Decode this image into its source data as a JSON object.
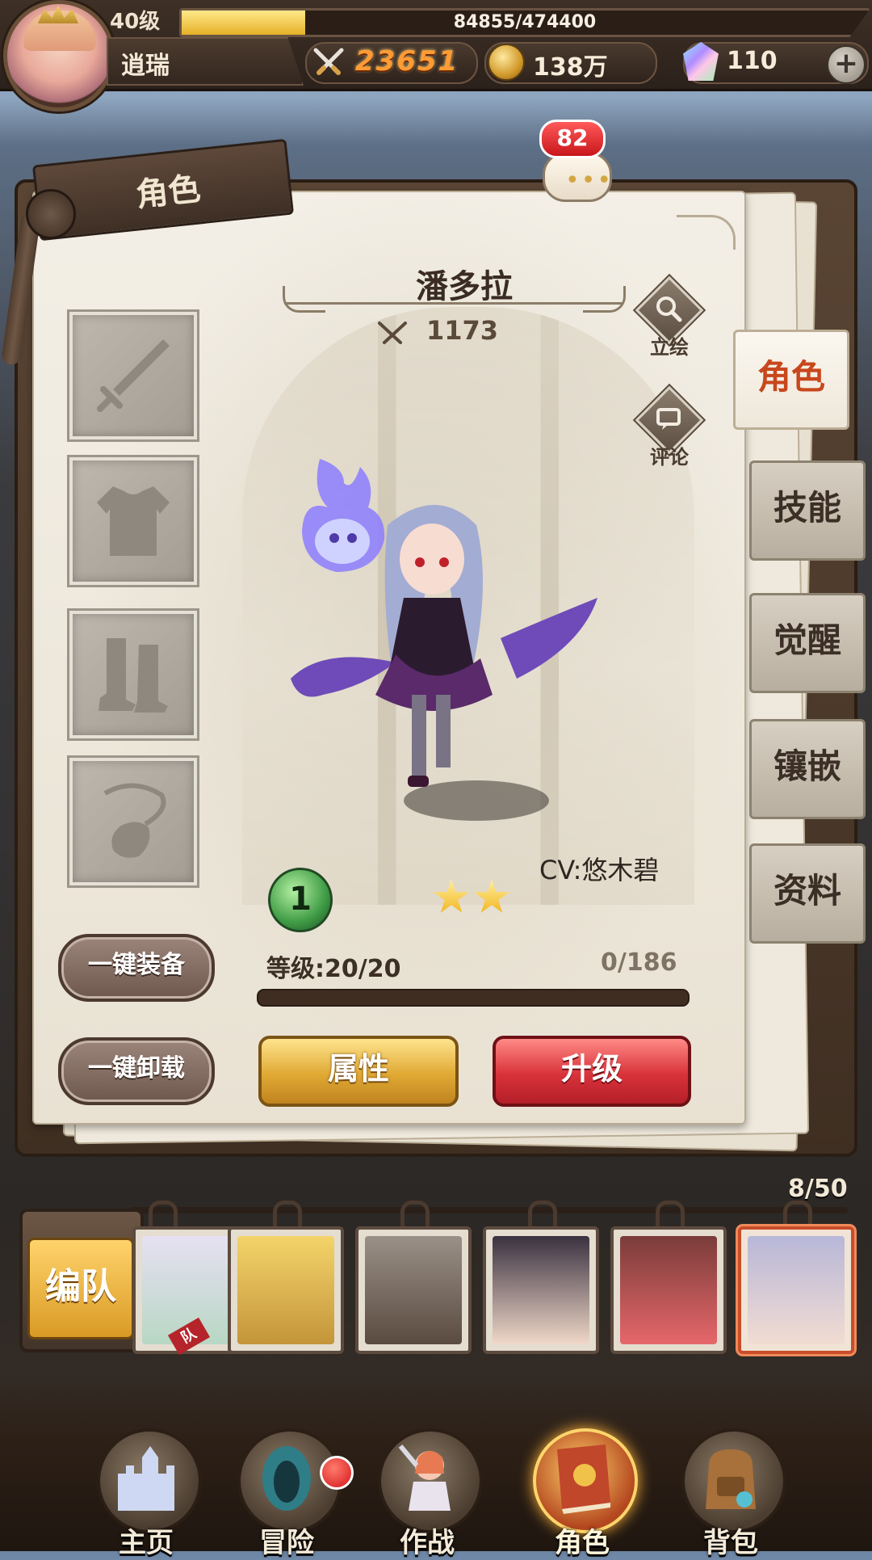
{
  "player": {
    "level": "40级",
    "exp": "84855/474400",
    "exp_fraction": 0.18,
    "name": "逍瑞",
    "power": "23651",
    "coins": "138万",
    "gems": "110",
    "plus": "+"
  },
  "comment_badge": "82",
  "panel": {
    "tab_label": "角色",
    "hero_name": "潘多拉",
    "hero_power": "1173",
    "actions": [
      {
        "label": "立绘",
        "icon": "magnify-icon"
      },
      {
        "label": "评论",
        "icon": "comment-icon"
      }
    ],
    "equipment_slots": [
      "weapon-slot",
      "armor-slot",
      "boots-slot",
      "accessory-slot"
    ],
    "cv": "CV:悠木碧",
    "rank": "1",
    "stars": 2,
    "level_text": "等级:20/20",
    "xp_text": "0/186",
    "xp_fraction": 0,
    "buttons": {
      "equip_all": "一键装备",
      "unequip_all": "一键卸载",
      "attributes": "属性",
      "upgrade": "升级"
    }
  },
  "side_tabs": [
    {
      "label": "角色",
      "active": true
    },
    {
      "label": "技能",
      "active": false
    },
    {
      "label": "觉醒",
      "active": false
    },
    {
      "label": "镶嵌",
      "active": false
    },
    {
      "label": "资料",
      "active": false
    }
  ],
  "roster": {
    "formation_label": "编队",
    "count": "8/50",
    "team_tag": "队",
    "cards": [
      "hero-1",
      "hero-2",
      "hero-3",
      "hero-4",
      "hero-5",
      "hero-6"
    ]
  },
  "nav": [
    {
      "label": "主页",
      "active": false
    },
    {
      "label": "冒险",
      "active": false
    },
    {
      "label": "作战",
      "active": false
    },
    {
      "label": "角色",
      "active": true
    },
    {
      "label": "背包",
      "active": false
    }
  ],
  "colors": {
    "accent_active_tab": "#c8471d",
    "power_text": "#ff9b34",
    "upgrade_button": "#d9323b",
    "attribute_button": "#e0a934"
  }
}
